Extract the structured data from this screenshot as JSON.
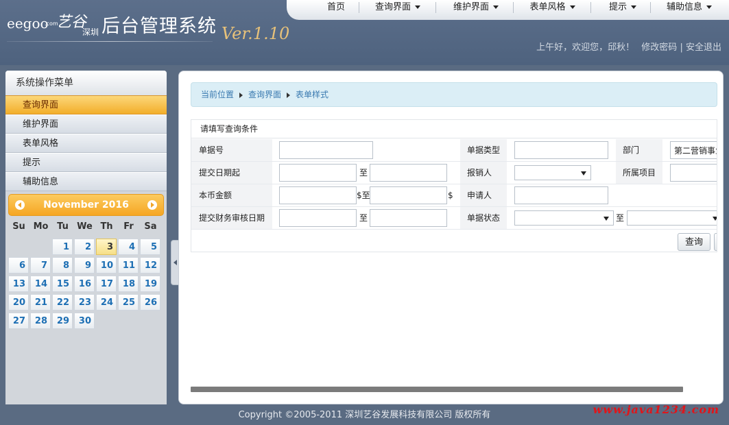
{
  "header": {
    "brand": "eegoo",
    "brand_com": ".com",
    "brand_cn": "艺谷",
    "brand_city": "深圳",
    "system_title": "后台管理系统",
    "version": "Ver.1.10"
  },
  "topnav": {
    "items": [
      {
        "label": "首页",
        "dropdown": false
      },
      {
        "label": "查询界面",
        "dropdown": true
      },
      {
        "label": "维护界面",
        "dropdown": true
      },
      {
        "label": "表单风格",
        "dropdown": true
      },
      {
        "label": "提示",
        "dropdown": true
      },
      {
        "label": "辅助信息",
        "dropdown": true
      }
    ]
  },
  "welcome": {
    "greeting": "上午好，欢迎您，邱秋！",
    "change_password": "修改密码",
    "divider": "|",
    "logout": "安全退出"
  },
  "sidebar": {
    "title": "系统操作菜单",
    "items": [
      {
        "label": "查询界面",
        "active": true
      },
      {
        "label": "维护界面",
        "active": false
      },
      {
        "label": "表单风格",
        "active": false
      },
      {
        "label": "提示",
        "active": false
      },
      {
        "label": "辅助信息",
        "active": false
      }
    ]
  },
  "calendar": {
    "month_label": "November 2016",
    "weekdays": [
      "Su",
      "Mo",
      "Tu",
      "We",
      "Th",
      "Fr",
      "Sa"
    ],
    "first_weekday_index": 2,
    "days_in_month": 30,
    "today": 3
  },
  "breadcrumb": {
    "items": [
      "当前位置",
      "查询界面",
      "表单样式"
    ]
  },
  "form": {
    "caption": "请填写查询条件",
    "row1": {
      "bill_no_label": "单据号",
      "bill_no_value": "",
      "bill_type_label": "单据类型",
      "bill_type_value": "",
      "dept_label": "部门",
      "dept_value": "第二营销事业"
    },
    "row2": {
      "submit_date_label": "提交日期起",
      "to": "至",
      "reimburser_label": "报销人",
      "reimburser_value": "",
      "project_label": "所属项目",
      "project_value": ""
    },
    "row3": {
      "amount_label": "本币金额",
      "to": "$至",
      "currency_suffix": "$",
      "applicant_label": "申请人",
      "applicant_value": ""
    },
    "row4": {
      "audit_date_label": "提交财务审核日期",
      "to": "至",
      "status_label": "单据状态",
      "status_value": "",
      "status_to": "至"
    },
    "query_button": "查询"
  },
  "footer": {
    "copyright": "Copyright ©2005-2011 深圳艺谷发展科技有限公司 版权所有",
    "watermark": "www.java1234.com"
  },
  "colors": {
    "header_bg": "#5c6f8b",
    "active_menu": "#f2ae2a",
    "calendar_head": "#f5a623",
    "link_blue": "#1d6fb4",
    "breadcrumb_bg": "#dbeef6",
    "watermark_red": "#e0151a"
  }
}
